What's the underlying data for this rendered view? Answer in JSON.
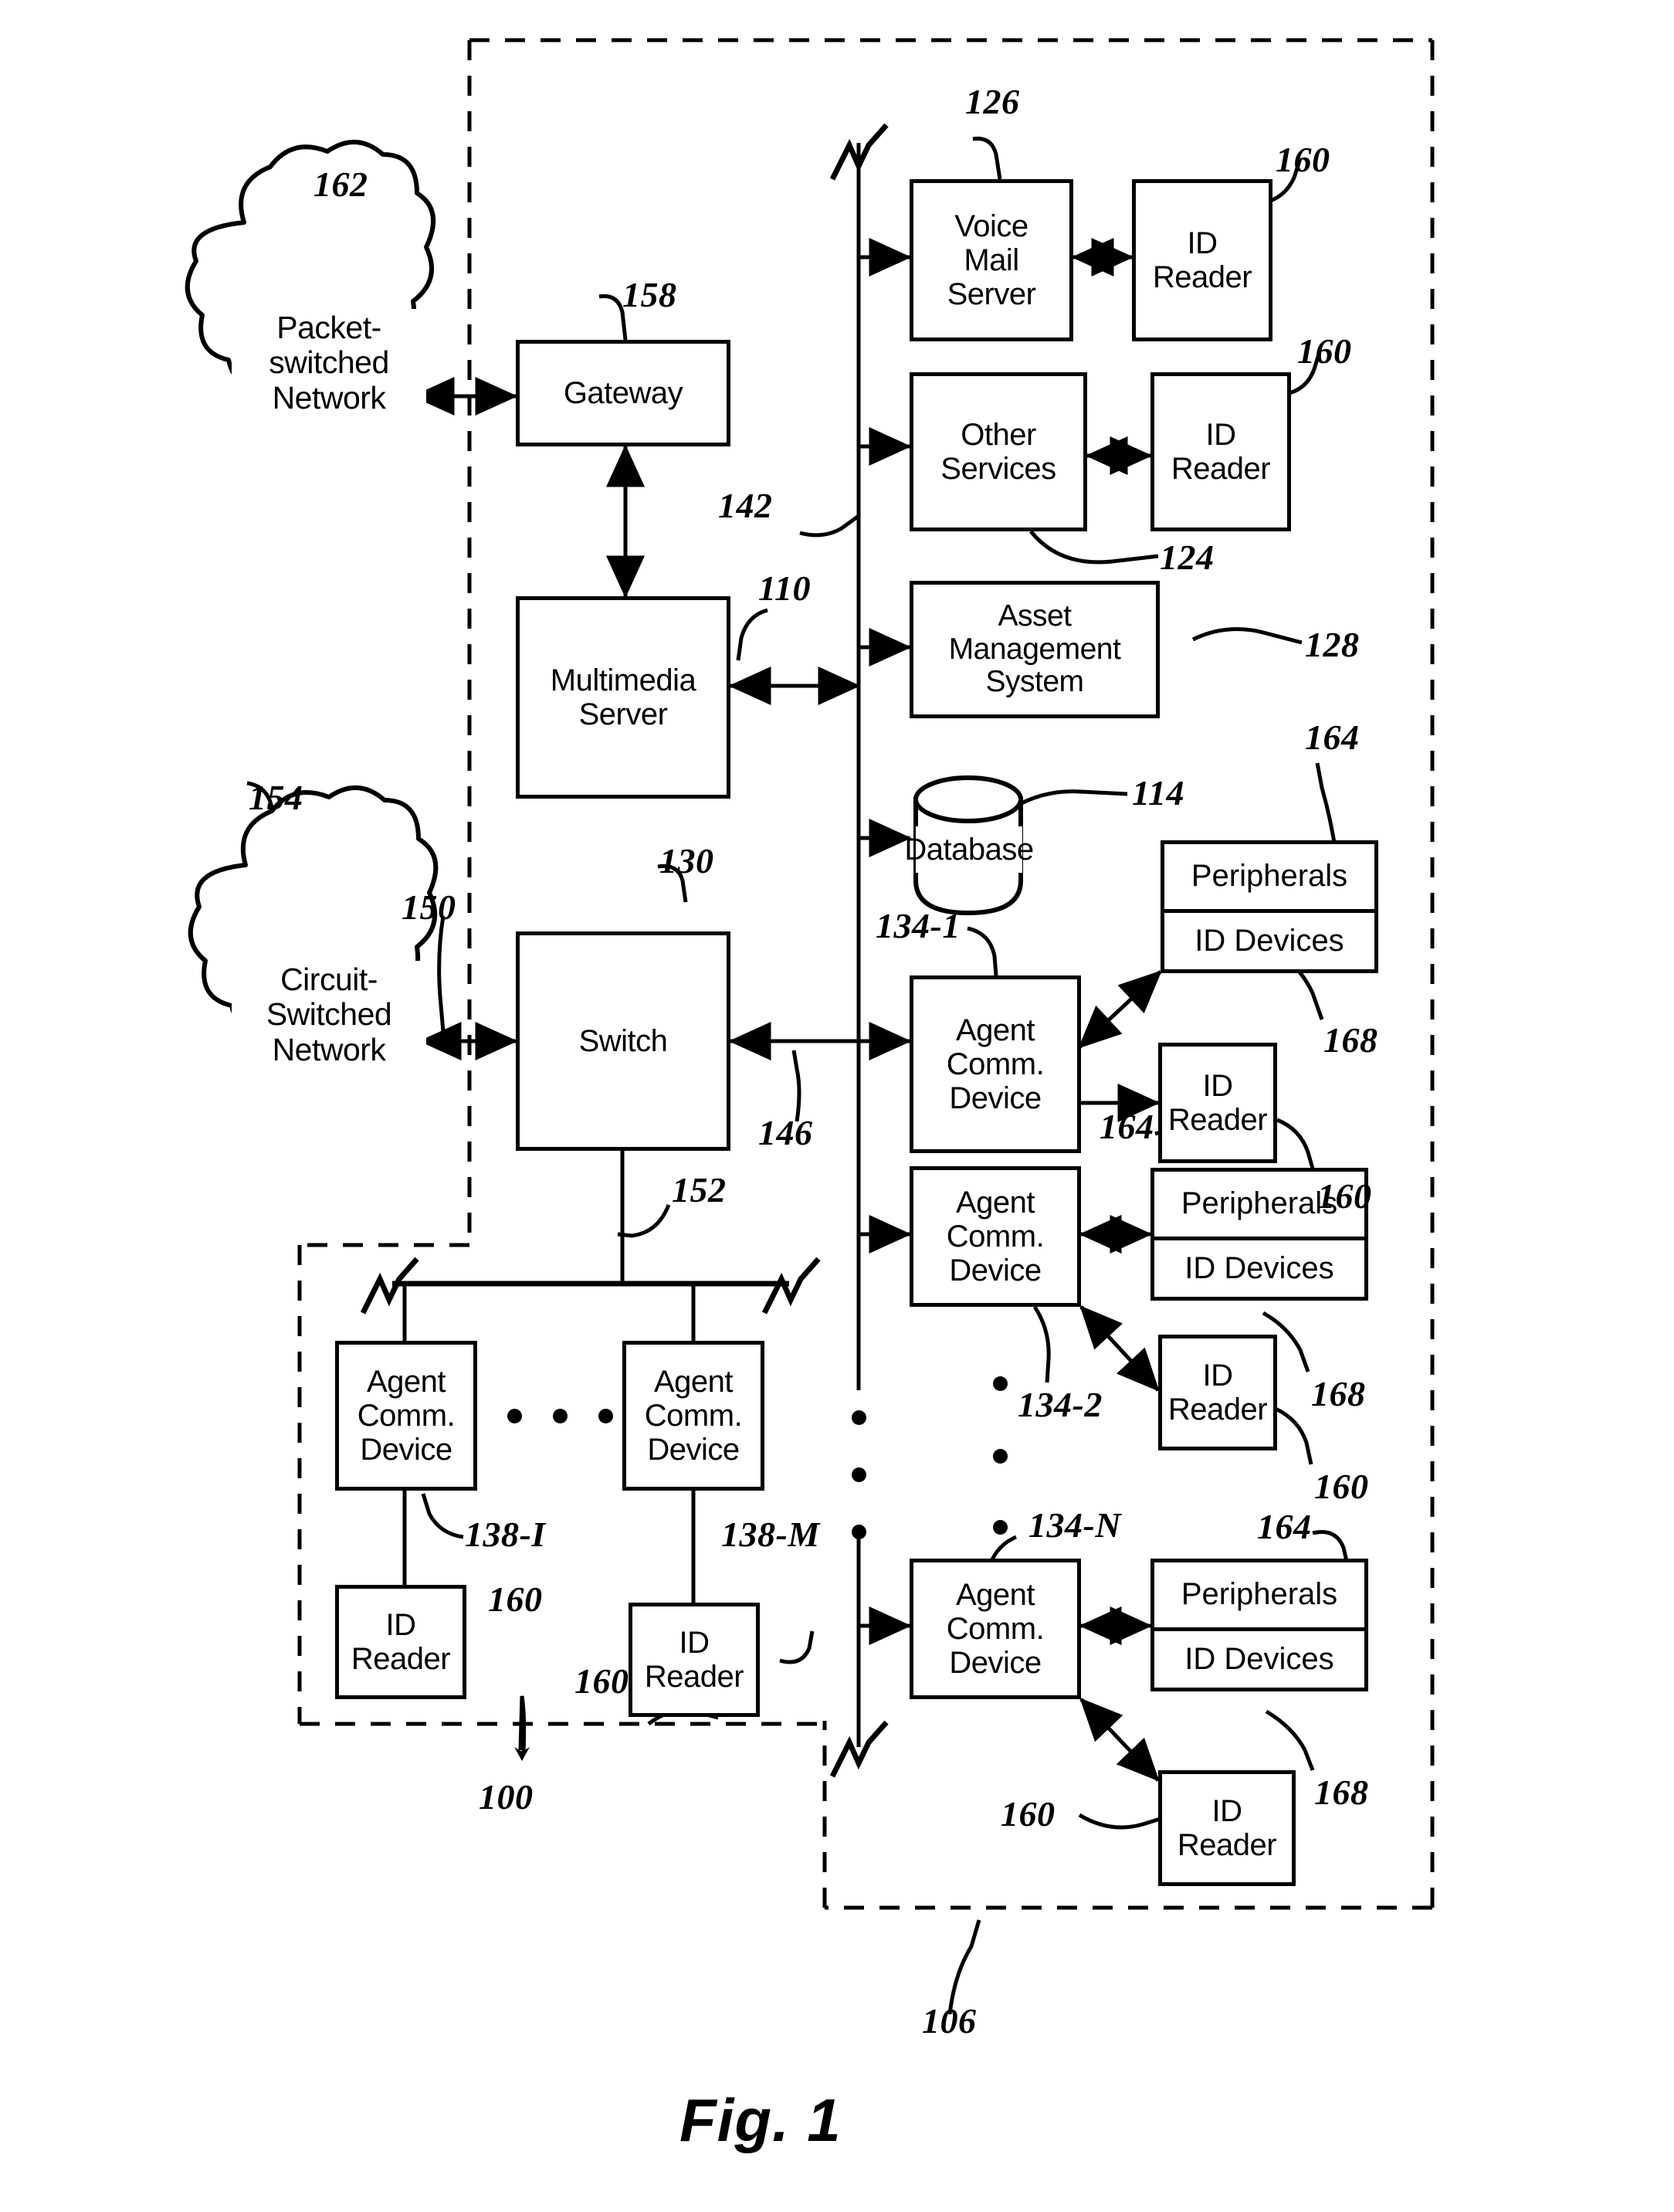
{
  "figure": {
    "caption": "Fig. 1",
    "title_ref": "100",
    "contact_center_ref": "106"
  },
  "networks": [
    {
      "id": "packet",
      "lines": [
        "Packet-",
        "switched",
        "Network"
      ],
      "ref": "162"
    },
    {
      "id": "circuit",
      "lines": [
        "Circuit-",
        "Switched",
        "Network"
      ],
      "ref": "154"
    }
  ],
  "blocks": {
    "gateway": {
      "lines": [
        "Gateway"
      ],
      "ref": "158"
    },
    "multimedia_server": {
      "lines": [
        "Multimedia",
        "Server"
      ],
      "ref": "110"
    },
    "switch": {
      "lines": [
        "Switch"
      ],
      "ref": "130"
    },
    "voice_mail_server": {
      "lines": [
        "Voice",
        "Mail",
        "Server"
      ],
      "ref": "126"
    },
    "other_services": {
      "lines": [
        "Other",
        "Services"
      ],
      "ref": "124"
    },
    "asset_management": {
      "lines": [
        "Asset",
        "Management",
        "System"
      ],
      "ref": "128"
    },
    "database": {
      "lines": [
        "Database"
      ],
      "ref": "114"
    }
  },
  "id_readers": [
    {
      "id": "vm-reader",
      "lines": [
        "ID",
        "Reader"
      ],
      "ref": "160"
    },
    {
      "id": "other-reader",
      "lines": [
        "ID",
        "Reader"
      ],
      "ref": "160"
    },
    {
      "id": "acd1-reader",
      "lines": [
        "ID",
        "Reader"
      ],
      "ref": "160"
    },
    {
      "id": "acd2-reader",
      "lines": [
        "ID",
        "Reader"
      ],
      "ref": "160"
    },
    {
      "id": "acdn-reader",
      "lines": [
        "ID",
        "Reader"
      ],
      "ref": "160"
    },
    {
      "id": "lan1-reader",
      "lines": [
        "ID",
        "Reader"
      ],
      "ref": "160"
    },
    {
      "id": "lanm-reader",
      "lines": [
        "ID",
        "Reader"
      ],
      "ref": "160"
    }
  ],
  "agent_devices": [
    {
      "id": "acd-1",
      "lines": [
        "Agent",
        "Comm.",
        "Device"
      ],
      "ref": "134-1"
    },
    {
      "id": "acd-2",
      "lines": [
        "Agent",
        "Comm.",
        "Device"
      ],
      "ref": "134-2"
    },
    {
      "id": "acd-n",
      "lines": [
        "Agent",
        "Comm.",
        "Device"
      ],
      "ref": "134-N"
    },
    {
      "id": "acd-i",
      "lines": [
        "Agent",
        "Comm.",
        "Device"
      ],
      "ref": "138-I"
    },
    {
      "id": "acd-m",
      "lines": [
        "Agent",
        "Comm.",
        "Device"
      ],
      "ref": "138-M"
    }
  ],
  "peripherals": [
    {
      "id": "per-1",
      "upper": "Peripherals",
      "lower": "ID Devices",
      "ref_upper": "164",
      "ref_lower": "168"
    },
    {
      "id": "per-2",
      "upper": "Peripherals",
      "lower": "ID Devices",
      "ref_upper": "164",
      "ref_lower": "168"
    },
    {
      "id": "per-n",
      "upper": "Peripherals",
      "lower": "ID Devices",
      "ref_upper": "164",
      "ref_lower": "168"
    }
  ],
  "link_refs": {
    "server_bus": "142",
    "switch_trunk": "146",
    "lan": "152",
    "csn_link": "150"
  },
  "refs": {
    "r100": "100",
    "r106": "106",
    "r110": "110",
    "r114": "114",
    "r124": "124",
    "r126": "126",
    "r128": "128",
    "r130": "130",
    "r134_1": "134-1",
    "r134_2": "134-2",
    "r134_N": "134-N",
    "r138_I": "138-I",
    "r138_M": "138-M",
    "r142": "142",
    "r146": "146",
    "r150": "150",
    "r152": "152",
    "r154": "154",
    "r158": "158",
    "r160a": "160",
    "r160b": "160",
    "r160c": "160",
    "r160d": "160",
    "r160e": "160",
    "r160f": "160",
    "r160g": "160",
    "r162": "162",
    "r164a": "164",
    "r164b": "164",
    "r164c": "164",
    "r168a": "168",
    "r168b": "168",
    "r168c": "168"
  },
  "colors": {
    "ink": "#000000",
    "paper": "#ffffff"
  }
}
